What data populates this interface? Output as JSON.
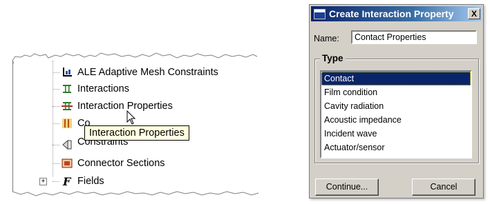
{
  "tree": {
    "items": [
      {
        "label": "ALE Adaptive Mesh Constraints",
        "icon": "ale-constraint-icon"
      },
      {
        "label": "Interactions",
        "icon": "interaction-icon"
      },
      {
        "label": "Interaction Properties",
        "icon": "interaction-property-icon"
      },
      {
        "label": "Co",
        "icon": "contact-control-icon"
      },
      {
        "label": "Constraints",
        "icon": "constraint-icon"
      },
      {
        "label": "Connector Sections",
        "icon": "connector-section-icon"
      },
      {
        "label": "Fields",
        "icon": "field-icon",
        "expand": "+"
      }
    ],
    "tooltip": "Interaction Properties"
  },
  "dialog": {
    "title": "Create Interaction Property",
    "close": "X",
    "name_label": "Name:",
    "name_value": "Contact Properties",
    "type_group": "Type",
    "types": [
      "Contact",
      "Film condition",
      "Cavity radiation",
      "Acoustic impedance",
      "Incident wave",
      "Actuator/sensor"
    ],
    "selected_type": "Contact",
    "continue_label": "Continue...",
    "cancel_label": "Cancel"
  },
  "colors": {
    "title_gradient_start": "#0a246a",
    "selection": "#0a246a",
    "tooltip_bg": "#ffffe1",
    "dialog_bg": "#d4d0c8"
  }
}
